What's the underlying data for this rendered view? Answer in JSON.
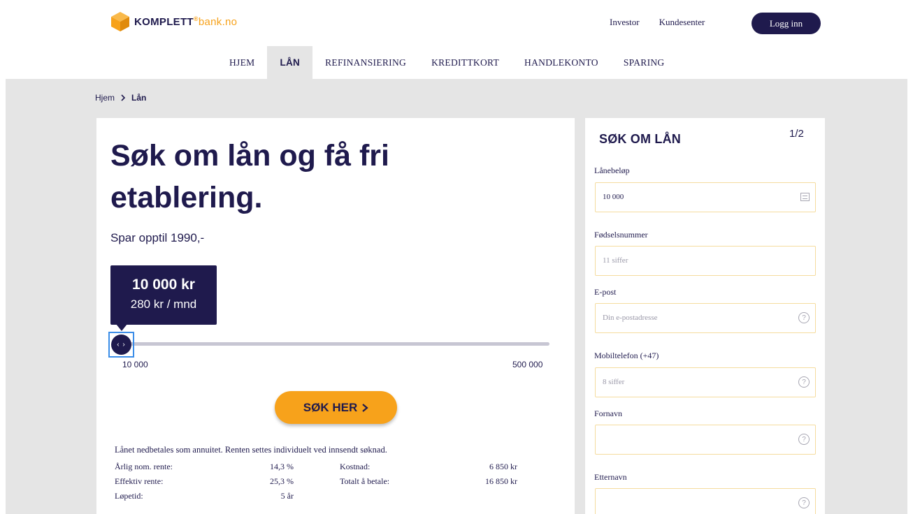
{
  "brand": {
    "name": "KOMPLETT",
    "sup": "®",
    "domain": "bank.no",
    "accent": "#f7a21b",
    "primary": "#1f1a4d"
  },
  "header": {
    "links": [
      "Investor",
      "Kundesenter"
    ],
    "login_label": "Logg inn"
  },
  "nav": {
    "items": [
      {
        "label": "HJEM"
      },
      {
        "label": "LÅN"
      },
      {
        "label": "REFINANSIERING"
      },
      {
        "label": "KREDITTKORT"
      },
      {
        "label": "HANDLEKONTO"
      },
      {
        "label": "SPARING"
      }
    ],
    "active": "LÅN"
  },
  "breadcrumb": {
    "home": "Hjem",
    "current": "Lån"
  },
  "hero": {
    "title": "Søk om lån og få fri etablering.",
    "subtitle": "Spar opptil 1990,-"
  },
  "calculator": {
    "amount": "10 000 kr",
    "monthly": "280 kr / mnd",
    "min": "10 000",
    "max": "500 000",
    "level": 0,
    "cta": "SØK HER"
  },
  "terms": {
    "note": "Lånet nedbetales som annuitet. Renten settes individuelt ved innsendt søknad.",
    "left": [
      {
        "label": "Årlig nom. rente:",
        "value": "14,3 %"
      },
      {
        "label": "Effektiv rente:",
        "value": "25,3 %"
      },
      {
        "label": "Løpetid:",
        "value": "5 år"
      }
    ],
    "right": [
      {
        "label": "Kostnad:",
        "value": "6 850 kr"
      },
      {
        "label": "Totalt å betale:",
        "value": "16 850 kr"
      }
    ]
  },
  "form": {
    "title": "SØK OM LÅN",
    "step": "1/2",
    "fields": [
      {
        "label": "Lånebeløp",
        "value": "10 000",
        "placeholder": "",
        "icon": "calculator-icon"
      },
      {
        "label": "Fødselsnummer",
        "value": "",
        "placeholder": "11 siffer",
        "icon": ""
      },
      {
        "label": "E-post",
        "value": "",
        "placeholder": "Din e-postadresse",
        "icon": "help-icon"
      },
      {
        "label": "Mobiltelefon (+47)",
        "value": "",
        "placeholder": "8 siffer",
        "icon": "help-icon"
      },
      {
        "label": "Fornavn",
        "value": "",
        "placeholder": "",
        "icon": "help-icon"
      },
      {
        "label": "Etternavn",
        "value": "",
        "placeholder": "",
        "icon": "help-icon"
      }
    ]
  }
}
